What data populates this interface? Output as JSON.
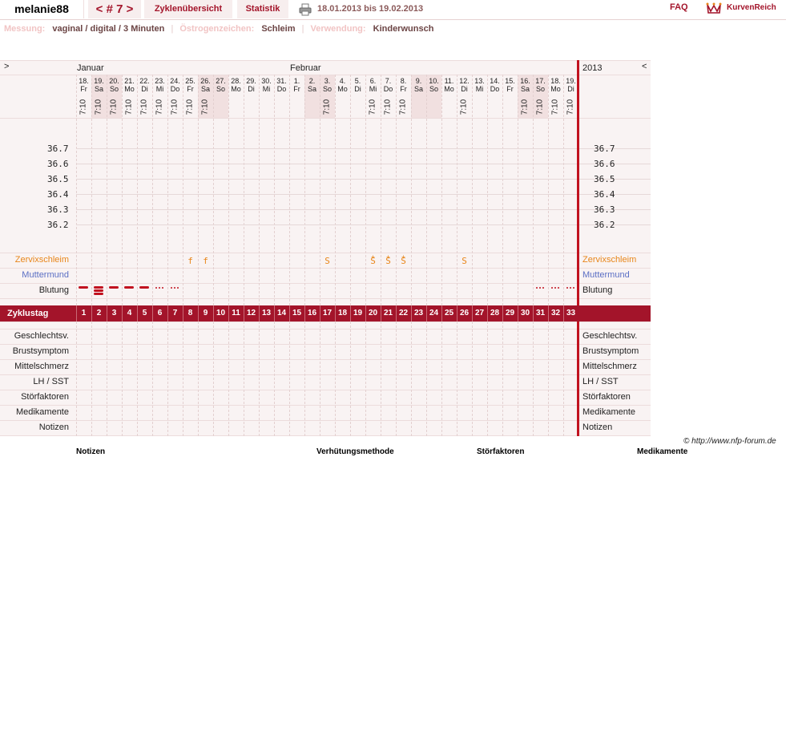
{
  "header": {
    "username": "melanie88",
    "cycle_nav": "< # 7 >",
    "tab_overview": "Zyklenübersicht",
    "tab_stats": "Statistik",
    "date_range": "18.01.2013 bis 19.02.2013",
    "faq": "FAQ",
    "logo": "KurvenReich"
  },
  "info": {
    "measurement_label": "Messung:",
    "measurement_value": "vaginal / digital / 3 Minuten",
    "estrogen_label": "Östrogenzeichen:",
    "estrogen_value": "Schleim",
    "usage_label": "Verwendung:",
    "usage_value": "Kinderwunsch"
  },
  "chart": {
    "nav_prev": ">",
    "nav_next": "<",
    "months": [
      {
        "label": "Januar",
        "start_index": 0
      },
      {
        "label": "Februar",
        "start_index": 14
      }
    ],
    "year": "2013",
    "days": [
      {
        "num": "18.",
        "dow": "Fr",
        "time": "7:10",
        "weekend": false
      },
      {
        "num": "19.",
        "dow": "Sa",
        "time": "7:10",
        "weekend": true
      },
      {
        "num": "20.",
        "dow": "So",
        "time": "7:10",
        "weekend": true
      },
      {
        "num": "21.",
        "dow": "Mo",
        "time": "7:10",
        "weekend": false
      },
      {
        "num": "22.",
        "dow": "Di",
        "time": "7:10",
        "weekend": false
      },
      {
        "num": "23.",
        "dow": "Mi",
        "time": "7:10",
        "weekend": false
      },
      {
        "num": "24.",
        "dow": "Do",
        "time": "7:10",
        "weekend": false
      },
      {
        "num": "25.",
        "dow": "Fr",
        "time": "7:10",
        "weekend": false
      },
      {
        "num": "26.",
        "dow": "Sa",
        "time": "7:10",
        "weekend": true
      },
      {
        "num": "27.",
        "dow": "So",
        "time": "",
        "weekend": true
      },
      {
        "num": "28.",
        "dow": "Mo",
        "time": "",
        "weekend": false
      },
      {
        "num": "29.",
        "dow": "Di",
        "time": "",
        "weekend": false
      },
      {
        "num": "30.",
        "dow": "Mi",
        "time": "",
        "weekend": false
      },
      {
        "num": "31.",
        "dow": "Do",
        "time": "",
        "weekend": false
      },
      {
        "num": "1.",
        "dow": "Fr",
        "time": "",
        "weekend": false
      },
      {
        "num": "2.",
        "dow": "Sa",
        "time": "",
        "weekend": true
      },
      {
        "num": "3.",
        "dow": "So",
        "time": "7:10",
        "weekend": true
      },
      {
        "num": "4.",
        "dow": "Mo",
        "time": "",
        "weekend": false
      },
      {
        "num": "5.",
        "dow": "Di",
        "time": "",
        "weekend": false
      },
      {
        "num": "6.",
        "dow": "Mi",
        "time": "7:10",
        "weekend": false
      },
      {
        "num": "7.",
        "dow": "Do",
        "time": "7:10",
        "weekend": false
      },
      {
        "num": "8.",
        "dow": "Fr",
        "time": "7:10",
        "weekend": false
      },
      {
        "num": "9.",
        "dow": "Sa",
        "time": "",
        "weekend": true
      },
      {
        "num": "10.",
        "dow": "So",
        "time": "",
        "weekend": true
      },
      {
        "num": "11.",
        "dow": "Mo",
        "time": "",
        "weekend": false
      },
      {
        "num": "12.",
        "dow": "Di",
        "time": "7:10",
        "weekend": false
      },
      {
        "num": "13.",
        "dow": "Mi",
        "time": "",
        "weekend": false
      },
      {
        "num": "14.",
        "dow": "Do",
        "time": "",
        "weekend": false
      },
      {
        "num": "15.",
        "dow": "Fr",
        "time": "",
        "weekend": false
      },
      {
        "num": "16.",
        "dow": "Sa",
        "time": "7:10",
        "weekend": true
      },
      {
        "num": "17.",
        "dow": "So",
        "time": "7:10",
        "weekend": true
      },
      {
        "num": "18.",
        "dow": "Mo",
        "time": "7:10",
        "weekend": false
      },
      {
        "num": "19.",
        "dow": "Di",
        "time": "7:10",
        "weekend": false
      }
    ],
    "temp_scale": [
      "36.7",
      "36.6",
      "36.5",
      "36.4",
      "36.3",
      "36.2"
    ],
    "rows": {
      "mucus": "Zervixschleim",
      "cervix": "Muttermund",
      "bleeding": "Blutung",
      "cycle_day": "Zyklustag",
      "intercourse": "Geschlechtsv.",
      "breast": "Brustsymptom",
      "midpain": "Mittelschmerz",
      "lh": "LH / SST",
      "disturbances": "Störfaktoren",
      "medication": "Medikamente",
      "notes": "Notizen"
    },
    "mucus_marks": [
      {
        "day": 8,
        "sym": "f",
        "plus": ""
      },
      {
        "day": 9,
        "sym": "f",
        "plus": ""
      },
      {
        "day": 17,
        "sym": "S",
        "plus": ""
      },
      {
        "day": 20,
        "sym": "S",
        "plus": "+"
      },
      {
        "day": 21,
        "sym": "S",
        "plus": "+"
      },
      {
        "day": 22,
        "sym": "S",
        "plus": "+"
      },
      {
        "day": 26,
        "sym": "S",
        "plus": ""
      }
    ],
    "bleeding_marks": [
      {
        "day": 1,
        "type": "medium"
      },
      {
        "day": 2,
        "type": "heavy"
      },
      {
        "day": 3,
        "type": "medium"
      },
      {
        "day": 4,
        "type": "medium"
      },
      {
        "day": 5,
        "type": "medium"
      },
      {
        "day": 6,
        "type": "spotting"
      },
      {
        "day": 7,
        "type": "spotting"
      },
      {
        "day": 31,
        "type": "spotting"
      },
      {
        "day": 32,
        "type": "spotting"
      },
      {
        "day": 33,
        "type": "spotting"
      }
    ],
    "cycle_days": [
      "1",
      "2",
      "3",
      "4",
      "5",
      "6",
      "7",
      "8",
      "9",
      "10",
      "11",
      "12",
      "13",
      "14",
      "15",
      "16",
      "17",
      "18",
      "19",
      "20",
      "21",
      "22",
      "23",
      "24",
      "25",
      "26",
      "27",
      "28",
      "29",
      "30",
      "31",
      "32",
      "33"
    ]
  },
  "footer": {
    "copyright": "© http://www.nfp-forum.de",
    "legend_notes": "Notizen",
    "legend_contraception": "Verhütungsmethode",
    "legend_disturbances": "Störfaktoren",
    "legend_medication": "Medikamente"
  },
  "colors": {
    "brand": "#a3142a",
    "mucus": "#e8861a",
    "cervix": "#5b6fc4",
    "bleeding": "#c1121f"
  }
}
